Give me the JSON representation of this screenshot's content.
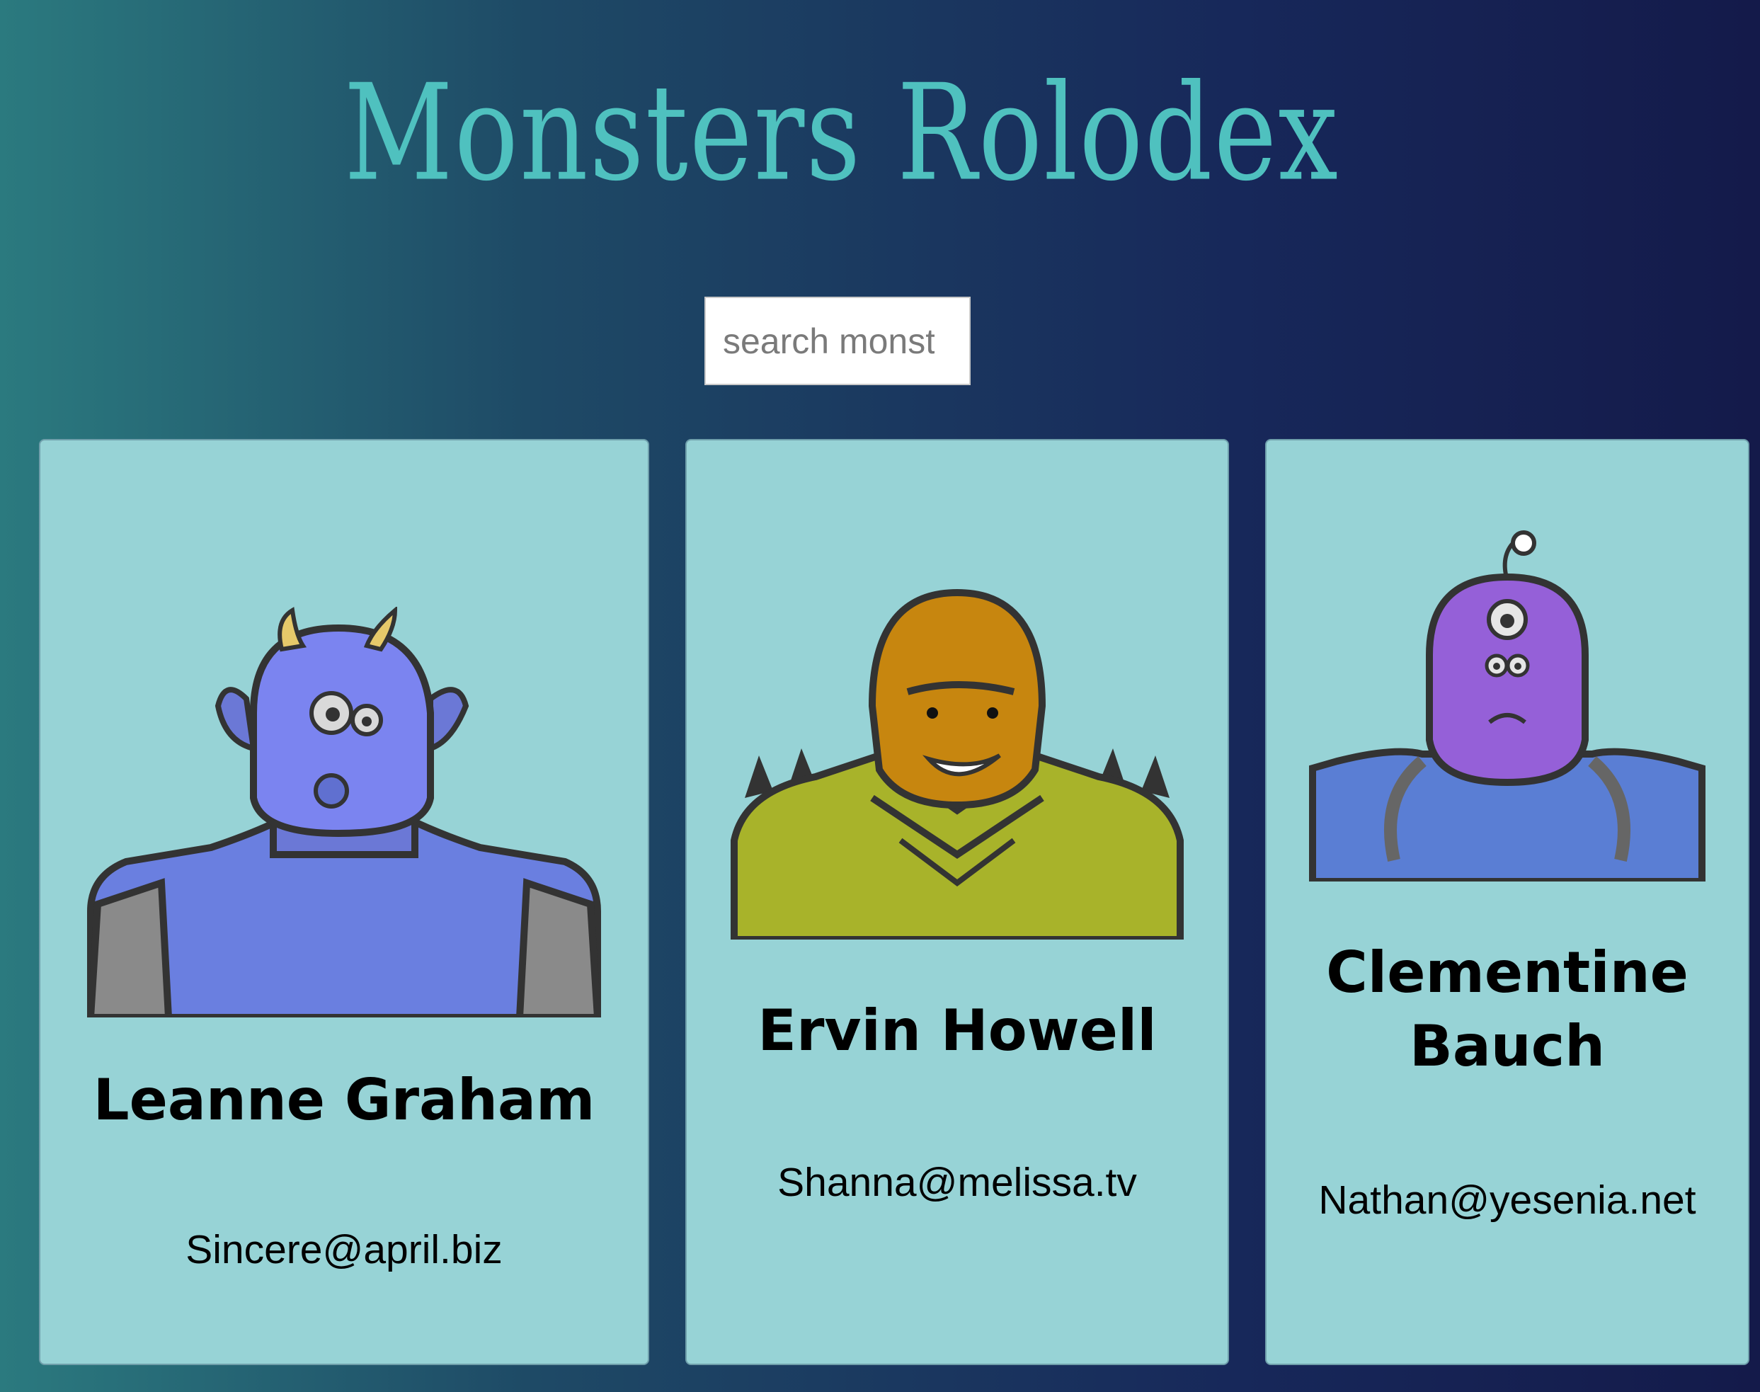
{
  "app": {
    "title": "Monsters Rolodex"
  },
  "search": {
    "placeholder": "search monsters",
    "value": ""
  },
  "monsters": [
    {
      "name": "Leanne Graham",
      "email": "Sincere@april.biz",
      "avatar": "horned-blue-monster-icon"
    },
    {
      "name": "Ervin Howell",
      "email": "Shanna@melissa.tv",
      "avatar": "orange-spiky-monster-icon"
    },
    {
      "name": "Clementine Bauch",
      "email": "Nathan@yesenia.net",
      "avatar": "purple-cyclops-robot-monster-icon"
    }
  ],
  "colors": {
    "title": "#4fc1bf",
    "card_background": "#97d3d6",
    "background_start": "#2b7a7f",
    "background_end": "#141a4a"
  }
}
